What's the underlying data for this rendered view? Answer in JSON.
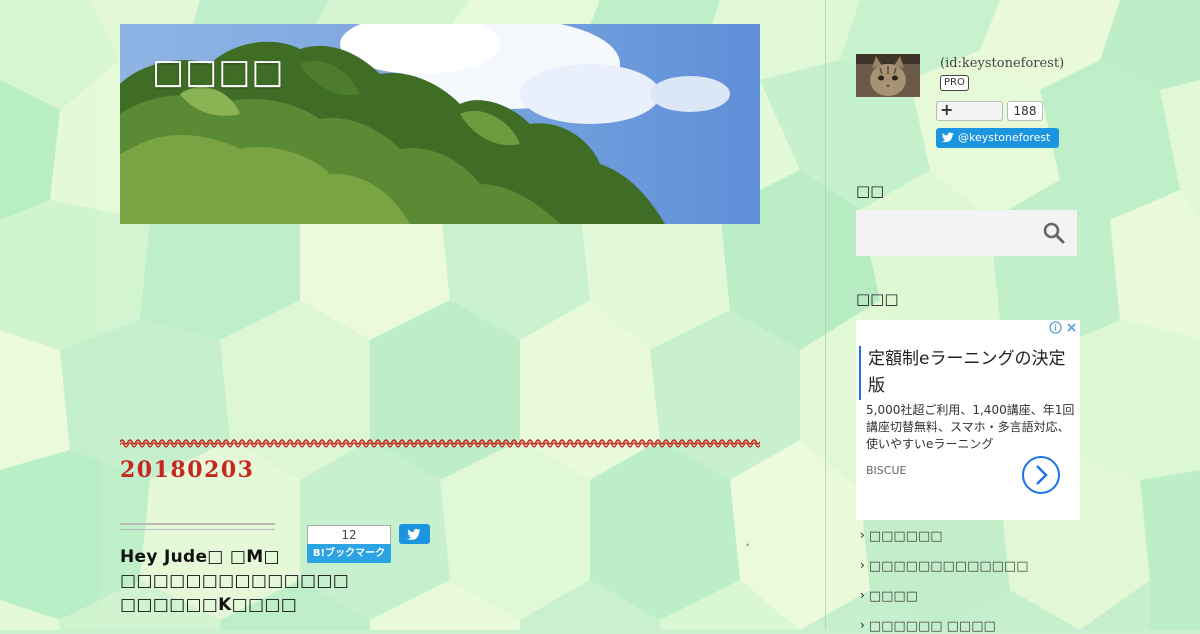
{
  "blog": {
    "title": "□□□□"
  },
  "entry": {
    "date": "20180203",
    "title": "Hey  Jude□ □M□ □□□□□□□□□□□□□□ □□□□□□K□□□□",
    "bookmark_count": "12",
    "bookmark_label": "B!ブックマーク",
    "tick": "ˏ"
  },
  "profile": {
    "id": "(id:keystoneforest)",
    "pro": "PRO",
    "follow_plus": "+",
    "follow_count": "188",
    "twitter_handle": "@keystoneforest"
  },
  "sidebar": {
    "search_title": "□□",
    "ad_section_title": "□□□",
    "links": [
      "□□□□□□",
      "□□□□□□□□□□□□□",
      "□□□□",
      "□□□□□□ □□□□"
    ]
  },
  "ad": {
    "headline": "定額制eラーニングの決定版",
    "body": "5,000社超ご利用、1,400講座、年1回講座切替無料、スマホ・多言語対応、使いやすいeラーニング",
    "advertiser": "BISCUE"
  },
  "colors": {
    "accent_red": "#c6261f",
    "hatena_blue": "#2ca3e3",
    "twitter_blue": "#1b95e0"
  }
}
